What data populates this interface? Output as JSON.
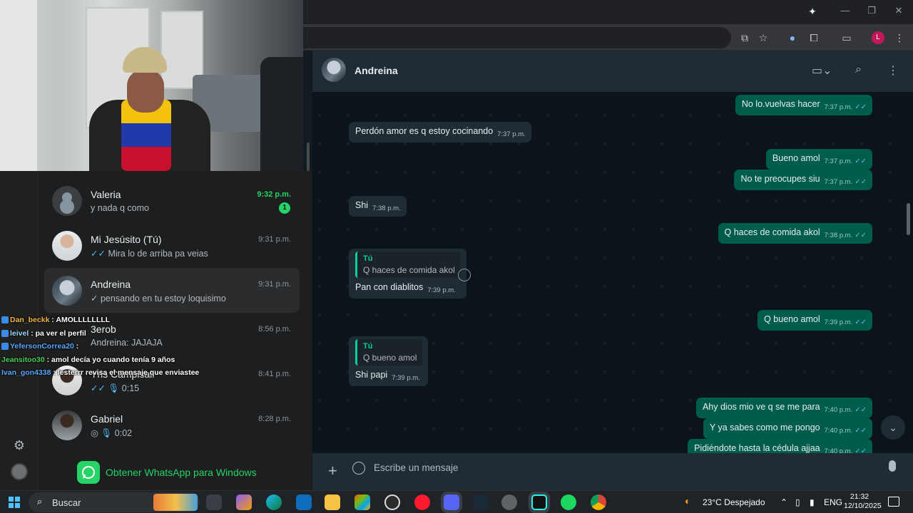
{
  "browser": {
    "colors": {
      "titlebar": "#202124",
      "toolbar": "#35363a",
      "profile": "#c2185b"
    },
    "profile_initial": "L",
    "icons": [
      "install-app-icon",
      "bookmark-star-icon",
      "extension-icon",
      "puzzle-icon",
      "cast-icon",
      "profile-icon",
      "more-icon"
    ]
  },
  "chat_list": [
    {
      "name": "Valeria",
      "time": "9:32 p.m.",
      "preview": "y nada q como",
      "unread": "1",
      "avatar": "default"
    },
    {
      "name": "Mi Jesúsito (Tú)",
      "time": "9:31 p.m.",
      "preview": "Mira lo de arriba pa veias",
      "tick": "✓✓"
    },
    {
      "name": "Andreina",
      "time": "9:31 p.m.",
      "preview": "pensando en tu estoy loquisimo",
      "tick": "✓"
    },
    {
      "name": "3erob",
      "time": "8:56 p.m.",
      "preview": "Andreina: JAJAJA"
    },
    {
      "name": "Yris Campisali",
      "time": "8:41 p.m.",
      "preview": "0:15",
      "tick": "✓✓"
    },
    {
      "name": "Gabriel",
      "time": "8:28 p.m.",
      "preview": "0:02"
    }
  ],
  "stream_chat": [
    {
      "user": "Dan_beckk",
      "text": "AMOLLLLLLLL"
    },
    {
      "user": "leivel",
      "text": "pa ver el perfil"
    },
    {
      "user": "YefersonCorrea20",
      "text": ""
    },
    {
      "user": "Jeansitoo30",
      "text": "amol decía yo cuando tenía 9 años"
    },
    {
      "user": "Ivan_gon4338",
      "text": "lesterrr revisa el mensaje que enviastee"
    }
  ],
  "get_app_label": "Obtener WhatsApp para Windows",
  "conversation": {
    "contact_name": "Andreina",
    "colors": {
      "bg": "#0b141a",
      "incoming": "#202c33",
      "outgoing": "#005c4b",
      "accent": "#25d366"
    },
    "messages": [
      {
        "dir": "out",
        "text": "No lo.vuelvas hacer",
        "time": "7:37 p.m."
      },
      {
        "dir": "in",
        "text": "Perdón amor es q estoy cocinando",
        "time": "7:37 p.m."
      },
      {
        "dir": "out",
        "text": "Bueno amol",
        "time": "7:37 p.m."
      },
      {
        "dir": "out",
        "text": "No te preocupes siu",
        "time": "7:37 p.m."
      },
      {
        "dir": "in",
        "text": "Shi",
        "time": "7:38 p.m."
      },
      {
        "dir": "out",
        "text": "Q haces de comida akol",
        "time": "7:38 p.m."
      },
      {
        "dir": "in",
        "quote_author": "Tú",
        "quote_text": "Q haces de comida akol",
        "text": "Pan con diablitos",
        "time": "7:39 p.m."
      },
      {
        "dir": "out",
        "text": "Q bueno amol",
        "time": "7:39 p.m."
      },
      {
        "dir": "in",
        "quote_author": "Tú",
        "quote_text": "Q bueno amol",
        "text": "Shi papi",
        "time": "7:39 p.m."
      },
      {
        "dir": "out",
        "text": "Ahy dios mio ve q se me para",
        "time": "7:40 p.m."
      },
      {
        "dir": "out",
        "text": "Y ya sabes como me pongo",
        "time": "7:40 p.m."
      },
      {
        "dir": "out",
        "text": "Pidiéndote hasta la cédula ajjaa",
        "time": "7:40 p.m."
      }
    ],
    "composer_placeholder": "Escribe un mensaje"
  },
  "taskbar": {
    "search_label": "Buscar",
    "weather": "23°C  Despejado",
    "language": "ENG",
    "time": "21:32",
    "date": "12/10/2025",
    "apps": [
      "task-view",
      "copilot",
      "edge",
      "outlook",
      "file-explorer",
      "store",
      "obs",
      "opera",
      "discord",
      "steam",
      "settings",
      "tiktok",
      "spotify",
      "chrome"
    ]
  }
}
